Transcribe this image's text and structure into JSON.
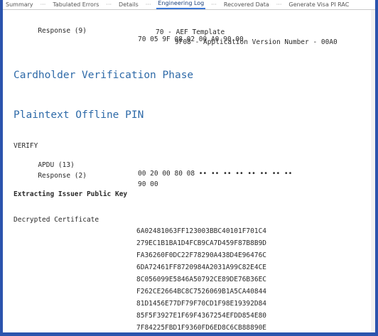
{
  "tabs": [
    {
      "label": "Summary"
    },
    {
      "label": "Tabulated Errors"
    },
    {
      "label": "Details"
    },
    {
      "label": "Engineering Log",
      "active": true
    },
    {
      "label": "Recovered Data"
    },
    {
      "label": "Generate Visa PI RAC"
    }
  ],
  "tab_separator": "···",
  "log": {
    "response9": {
      "label": "Response (9)",
      "value": "70 05 9F 08 02 00 A0 90 00"
    },
    "tag70": "70 - AEF Template",
    "tag9f08": "9F08 - Application Version Number - 00A0",
    "heading_cvp": "Cardholder Verification Phase",
    "heading_pin": "Plaintext Offline PIN",
    "verify": "VERIFY",
    "apdu": {
      "label": "APDU (13)",
      "value": "00 20 00 80 08 •• •• •• •• •• •• •• ••"
    },
    "response2": {
      "label": "Response (2)",
      "value": "90 00"
    },
    "extracting": "Extracting Issuer Public Key",
    "decrypted": "Decrypted Certificate",
    "cert_lines": [
      "6A02481063FF123003BBC40101F701C4",
      "279EC1B1BA1D4FCB9CA7D459F87B8B9D",
      "FA36260F0DC22F78290A438D4E96476C",
      "6DA72461FF8720984A2031A99C82E4CE",
      "8C056099E5846A50792CE89DE76B36EC",
      "F262CE2664BC8C7526069B1A5CA40844",
      "81D1456E77DF79F70CD1F98E19392D84",
      "85F5F3927E1F69F4367254EFDD854E80",
      "7F84225FBD1F9360FD6ED8C6CB88890E"
    ]
  }
}
